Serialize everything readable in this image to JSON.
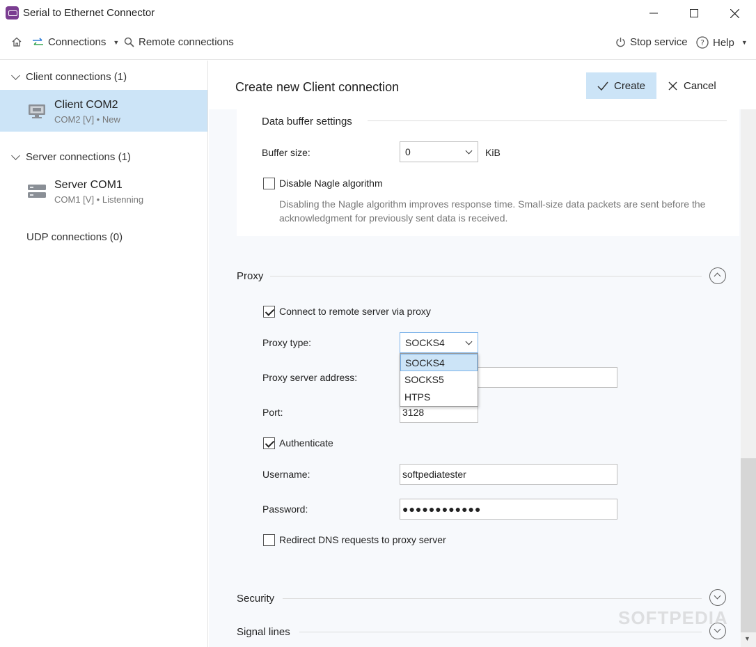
{
  "window": {
    "title": "Serial to Ethernet Connector"
  },
  "toolbar": {
    "connections_label": "Connections",
    "remote_label": "Remote connections",
    "stop_service_label": "Stop service",
    "help_label": "Help"
  },
  "sidebar": {
    "client_group": "Client connections (1)",
    "server_group": "Server connections (1)",
    "udp_group": "UDP connections (0)",
    "client_item": {
      "title": "Client COM2",
      "sub": "COM2 [V] • New"
    },
    "server_item": {
      "title": "Server COM1",
      "sub": "COM1 [V] • Listenning"
    }
  },
  "main": {
    "title": "Create new Client connection",
    "create_label": "Create",
    "cancel_label": "Cancel"
  },
  "buffer": {
    "section": "Data buffer settings",
    "size_label": "Buffer size:",
    "size_value": "0",
    "unit": "KiB",
    "nagle_label": "Disable Nagle algorithm",
    "nagle_checked": false,
    "nagle_help": "Disabling the Nagle algorithm improves response time. Small-size data packets are sent before the acknowledgment for previously sent data is received."
  },
  "proxy": {
    "section": "Proxy",
    "use_proxy_label": "Connect to remote server via proxy",
    "use_proxy_checked": true,
    "type_label": "Proxy type:",
    "type_value": "SOCKS4",
    "type_options": [
      "SOCKS4",
      "SOCKS5",
      "HTPS"
    ],
    "address_label": "Proxy server address:",
    "address_value": "",
    "port_label": "Port:",
    "port_value": "3128",
    "auth_label": "Authenticate",
    "auth_checked": true,
    "username_label": "Username:",
    "username_value": "softpediatester",
    "password_label": "Password:",
    "password_value": "●●●●●●●●●●●●",
    "dns_label": "Redirect DNS requests to proxy server",
    "dns_checked": false
  },
  "sections": {
    "security": "Security",
    "signal_lines": "Signal lines"
  },
  "watermark": "SOFTPEDIA",
  "colors": {
    "accent": "#cce4f7",
    "app_icon": "#7a3d91",
    "connections_icon_blue": "#2b7bd6",
    "connections_icon_green": "#3aa655"
  }
}
